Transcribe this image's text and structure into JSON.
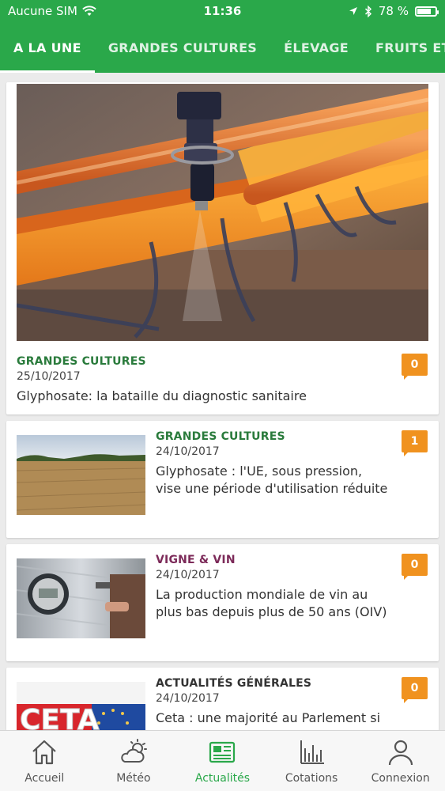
{
  "status_bar": {
    "carrier": "Aucune SIM",
    "time": "11:36",
    "battery": "78 %",
    "battery_level": 0.78
  },
  "tabs": [
    {
      "label": "A LA UNE",
      "active": true
    },
    {
      "label": "GRANDES CULTURES",
      "active": false
    },
    {
      "label": "ÉLEVAGE",
      "active": false
    },
    {
      "label": "FRUITS ET LÉGU",
      "active": false
    }
  ],
  "featured": {
    "category": "GRANDES CULTURES",
    "date": "25/10/2017",
    "title": "Glyphosate: la bataille du diagnostic sanitaire",
    "comments": "0"
  },
  "articles": [
    {
      "category": "GRANDES CULTURES",
      "date": "24/10/2017",
      "title": "Glyphosate : l'UE, sous pression, vise une période d'utilisation réduite",
      "comments": "1"
    },
    {
      "category": "VIGNE & VIN",
      "date": "24/10/2017",
      "title": "La production mondiale de vin au plus bas depuis plus de 50 ans (OIV)",
      "comments": "0"
    },
    {
      "category": "ACTUALITÉS GÉNÉRALES",
      "date": "24/10/2017",
      "title": "Ceta : une majorité au Parlement si \"nous",
      "comments": "0",
      "thumb_text": "CETA"
    }
  ],
  "tabbar": [
    {
      "label": "Accueil",
      "icon": "home-icon",
      "active": false
    },
    {
      "label": "Météo",
      "icon": "weather-icon",
      "active": false
    },
    {
      "label": "Actualités",
      "icon": "news-icon",
      "active": true
    },
    {
      "label": "Cotations",
      "icon": "chart-icon",
      "active": false
    },
    {
      "label": "Connexion",
      "icon": "user-icon",
      "active": false
    }
  ],
  "colors": {
    "brand": "#2aa84a",
    "badge": "#f0921f",
    "category_green": "#2a7b3c",
    "category_purple": "#7c2a59"
  }
}
